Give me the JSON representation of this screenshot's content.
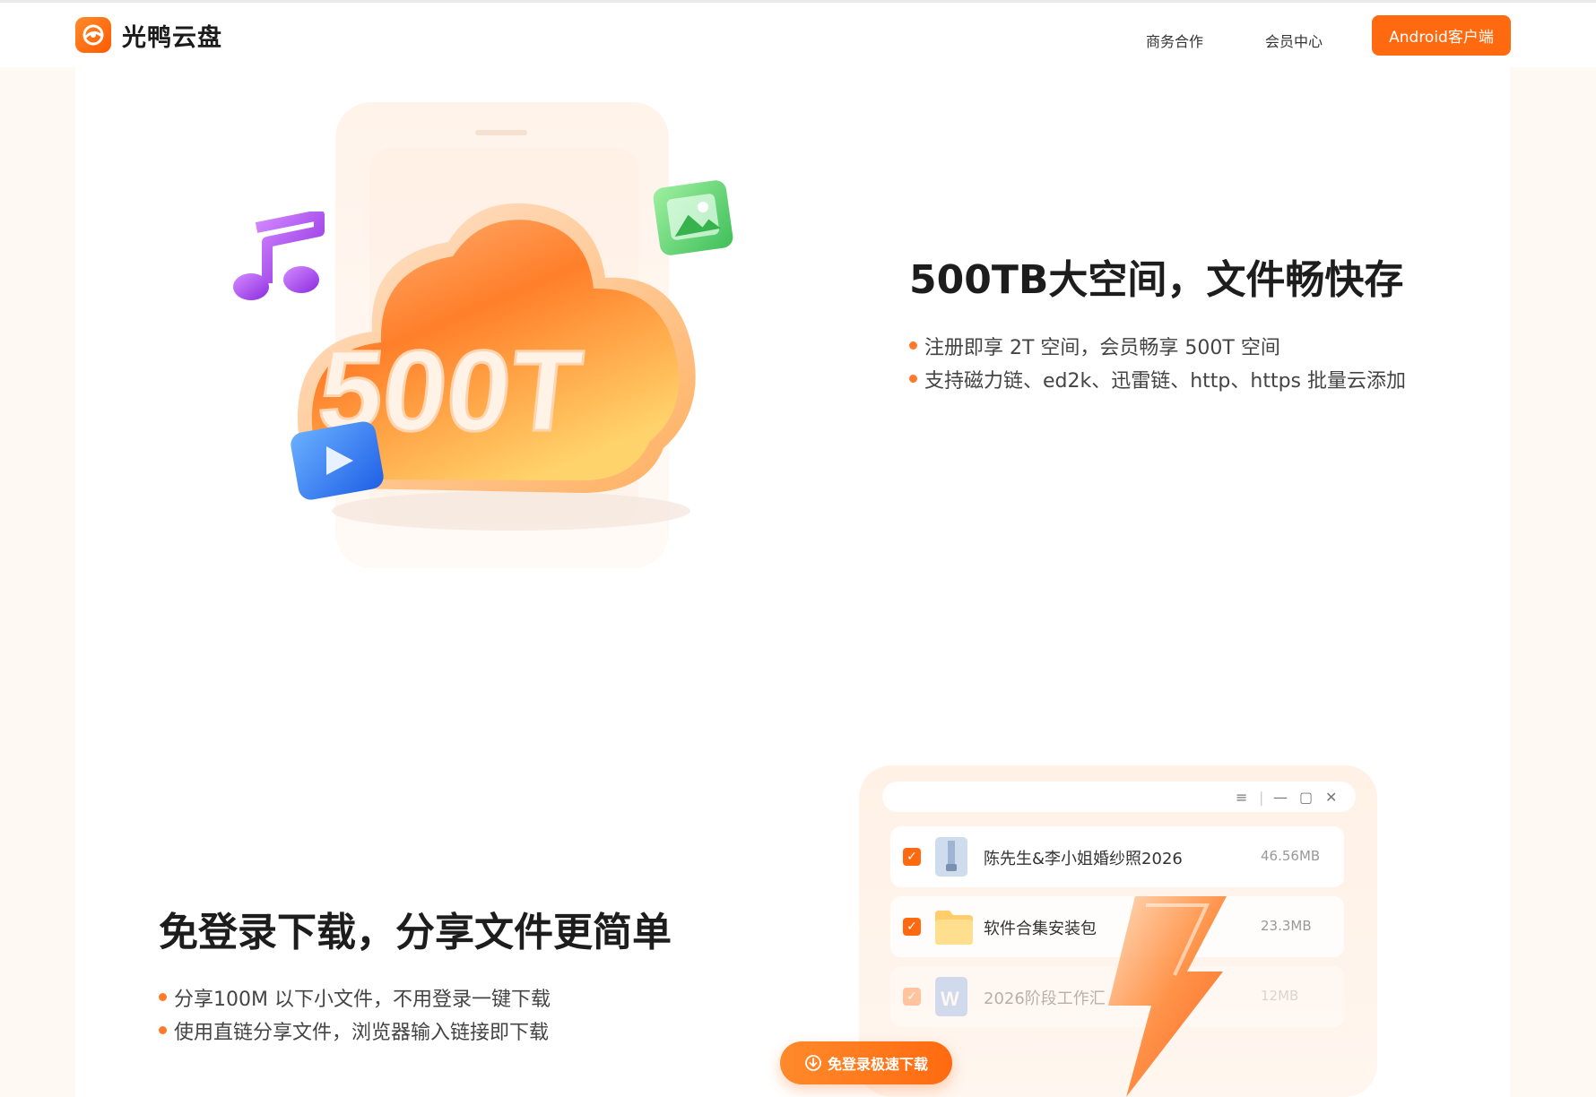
{
  "header": {
    "brand": "光鸭云盘",
    "nav": [
      {
        "label": "商务合作"
      },
      {
        "label": "会员中心"
      }
    ],
    "cta": "Android客户端"
  },
  "section1": {
    "graphic_text": "500T",
    "title": "500TB大空间，文件畅快存",
    "bullets": [
      "注册即享 2T 空间，会员畅享 500T 空间",
      "支持磁力链、ed2k、迅雷链、http、https 批量云添加"
    ]
  },
  "section2": {
    "title": "免登录下载，分享文件更简单",
    "bullets": [
      "分享100M 以下小文件，不用登录一键下载",
      "使用直链分享文件，浏览器输入链接即下载"
    ],
    "window_controls": [
      "≡",
      "|",
      "—",
      "▢",
      "✕"
    ],
    "files": [
      {
        "name": "陈先生&李小姐婚纱照2026",
        "size": "46.56MB",
        "icon": "zip-icon"
      },
      {
        "name": "软件合集安装包",
        "size": "23.3MB",
        "icon": "folder-icon"
      },
      {
        "name": "2026阶段工作汇",
        "size": "12MB",
        "icon": "word-doc-icon"
      }
    ],
    "download_button": "免登录极速下载"
  },
  "colors": {
    "accent": "#ff6a10",
    "background": "#fff9f4"
  }
}
